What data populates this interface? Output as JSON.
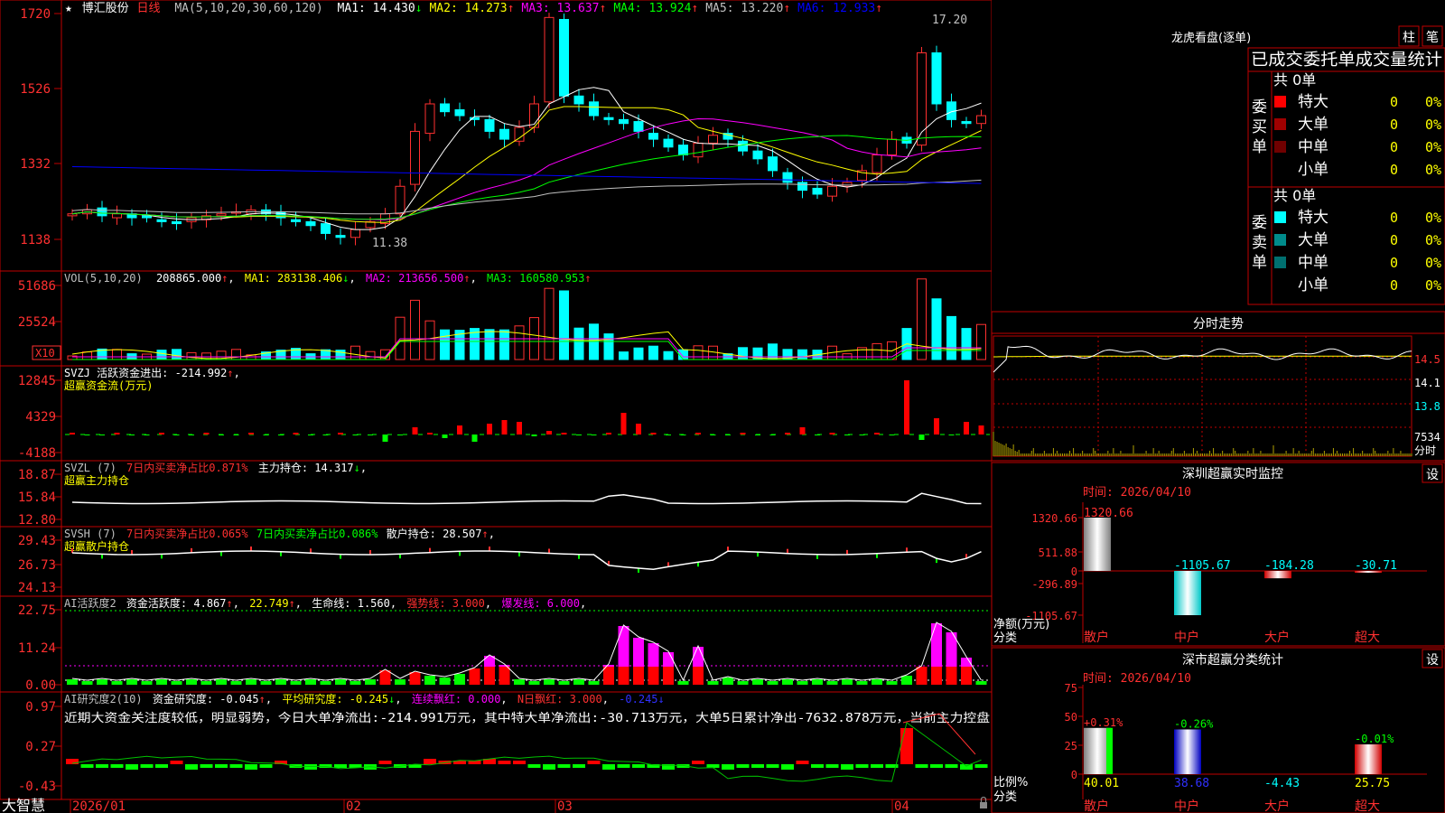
{
  "stock": {
    "star": "★",
    "name": "博汇股份",
    "period": "日线"
  },
  "main": {
    "ma_title": "MA(5,10,20,30,60,120)",
    "ma": [
      {
        "label": "MA1: 14.430",
        "arrow": "↓",
        "color": "#ffffff"
      },
      {
        "label": "MA2: 14.273",
        "arrow": "↑",
        "color": "#ffff00"
      },
      {
        "label": "MA3: 13.637",
        "arrow": "↑",
        "color": "#ff00ff"
      },
      {
        "label": "MA4: 13.924",
        "arrow": "↑",
        "color": "#00ff00"
      },
      {
        "label": "MA5: 13.220",
        "arrow": "↑",
        "color": "#c0c0c0"
      },
      {
        "label": "MA6: 12.933",
        "arrow": "↑",
        "color": "#0000ff"
      }
    ],
    "yticks": [
      "1720",
      "1526",
      "1332",
      "1138"
    ],
    "high_label": "17.20",
    "low_label": "11.38"
  },
  "vol": {
    "title": "VOL(5,10,20)",
    "value": "208865.000",
    "ma1": "MA1: 283138.406",
    "ma2": "MA2: 213656.500",
    "ma3": "MA3: 160580.953",
    "yticks": [
      "51686",
      "25524"
    ],
    "unit": "X10"
  },
  "svzj": {
    "line1": "SVZJ  活跃资金进出: -214.992",
    "line2": "超赢资金流(万元)",
    "yticks": [
      "12845",
      "4329",
      "-4188"
    ]
  },
  "svzl": {
    "title": "SVZL (7)",
    "t2": "7日内买卖净占比0.871%",
    "t3": "主力持仓: 14.317",
    "line2": "超赢主力持仓",
    "yticks": [
      "18.87",
      "15.84",
      "12.80"
    ]
  },
  "svsh": {
    "title": "SVSH (7)",
    "t2": "7日内买卖净占比0.065%",
    "t3": "7日内买卖净占比0.086%",
    "t4": "散户持仓: 28.507",
    "line2": "超赢散户持仓",
    "yticks": [
      "29.43",
      "26.73",
      "24.13"
    ]
  },
  "ai1": {
    "title": "AI活跃度2",
    "t1": "资金活跃度: 4.867",
    "t2": "22.749",
    "t3": "生命线: 1.560",
    "t4": "强势线: 3.000",
    "t5": "爆发线: 6.000",
    "yticks": [
      "22.75",
      "11.24",
      "0.00"
    ]
  },
  "ai2": {
    "title": "AI研究度2(10)",
    "t1": "资金研究度: -0.045",
    "t2": "平均研究度: -0.245",
    "t3": "连续飘红: 0.000",
    "t4": "N日飘红: 3.000",
    "t5": "-0.245",
    "comment": "近期大资金关注度较低，明显弱势，今日大单净流出:-214.991万元，其中特大单净流出:-30.713万元，大单5日累计净出-7632.878万元，当前主力控盘",
    "yticks": [
      "0.97",
      "0.27",
      "-0.43"
    ]
  },
  "xaxis": {
    "labels": [
      "2026/01",
      "02",
      "03",
      "04"
    ]
  },
  "logo": "大智慧",
  "lhb": {
    "title": "龙虎看盘(逐单)",
    "btn1": "柱",
    "btn2": "笔",
    "header": "已成交委托单成交量统计",
    "buy": {
      "group": "委买单",
      "total": "共 0单",
      "rows": [
        {
          "name": "特大",
          "color": "#ff0000",
          "val": "0",
          "pct": "0%"
        },
        {
          "name": "大单",
          "color": "#a00000",
          "val": "0",
          "pct": "0%"
        },
        {
          "name": "中单",
          "color": "#700000",
          "val": "0",
          "pct": "0%"
        },
        {
          "name": "小单",
          "color": "",
          "val": "0",
          "pct": "0%"
        }
      ]
    },
    "sell": {
      "group": "委卖单",
      "total": "共 0单",
      "rows": [
        {
          "name": "特大",
          "color": "#00ffff",
          "val": "0",
          "pct": "0%"
        },
        {
          "name": "大单",
          "color": "#008b8b",
          "val": "0",
          "pct": "0%"
        },
        {
          "name": "中单",
          "color": "#007070",
          "val": "0",
          "pct": "0%"
        },
        {
          "name": "小单",
          "color": "",
          "val": "0",
          "pct": "0%"
        }
      ]
    }
  },
  "fenshi": {
    "title": "分时走势",
    "yticks": [
      "14.5",
      "14.1",
      "13.8"
    ],
    "vol_tick": "7534",
    "vol_label": "分时"
  },
  "szmon": {
    "title": "深圳超赢实时监控",
    "btn": "设",
    "time": "时间: 2026/04/10",
    "yticks": [
      "1320.66",
      "511.88",
      "0",
      "-296.89",
      "-1105.67"
    ],
    "ylabel": "净额(万元)",
    "xlabel": "分类",
    "categories": [
      "散户",
      "中户",
      "大户",
      "超大"
    ],
    "value_labels": [
      "1320.66",
      "-1105.67",
      "-184.28",
      "-30.71"
    ]
  },
  "szcls": {
    "title": "深市超赢分类统计",
    "btn": "设",
    "time": "时间: 2026/04/10",
    "yticks": [
      "75",
      "50",
      "25",
      "0"
    ],
    "ylabel": "比例%",
    "xlabel": "分类",
    "categories": [
      "散户",
      "中户",
      "大户",
      "超大"
    ],
    "top_labels": [
      "+0.31%",
      "-0.26%",
      "",
      "-0.01%"
    ],
    "bottom_labels": [
      "40.01",
      "38.68",
      "-4.43",
      "25.75"
    ]
  },
  "chart_data": [
    {
      "type": "bar",
      "title": "深圳超赢实时监控",
      "categories": [
        "散户",
        "中户",
        "大户",
        "超大"
      ],
      "values": [
        1320.66,
        -1105.67,
        -184.28,
        -30.71
      ],
      "ylabel": "净额(万元)",
      "ylim": [
        -1105.67,
        1320.66
      ]
    },
    {
      "type": "bar",
      "title": "深市超赢分类统计",
      "categories": [
        "散户",
        "中户",
        "大户",
        "超大"
      ],
      "values": [
        40.01,
        38.68,
        -4.43,
        25.75
      ],
      "ylabel": "比例%",
      "ylim": [
        0,
        75
      ]
    },
    {
      "type": "line",
      "title": "博汇股份 日线",
      "y_unit": "price",
      "ylim": [
        11.38,
        17.2
      ],
      "high": 17.2,
      "low": 11.38
    }
  ]
}
